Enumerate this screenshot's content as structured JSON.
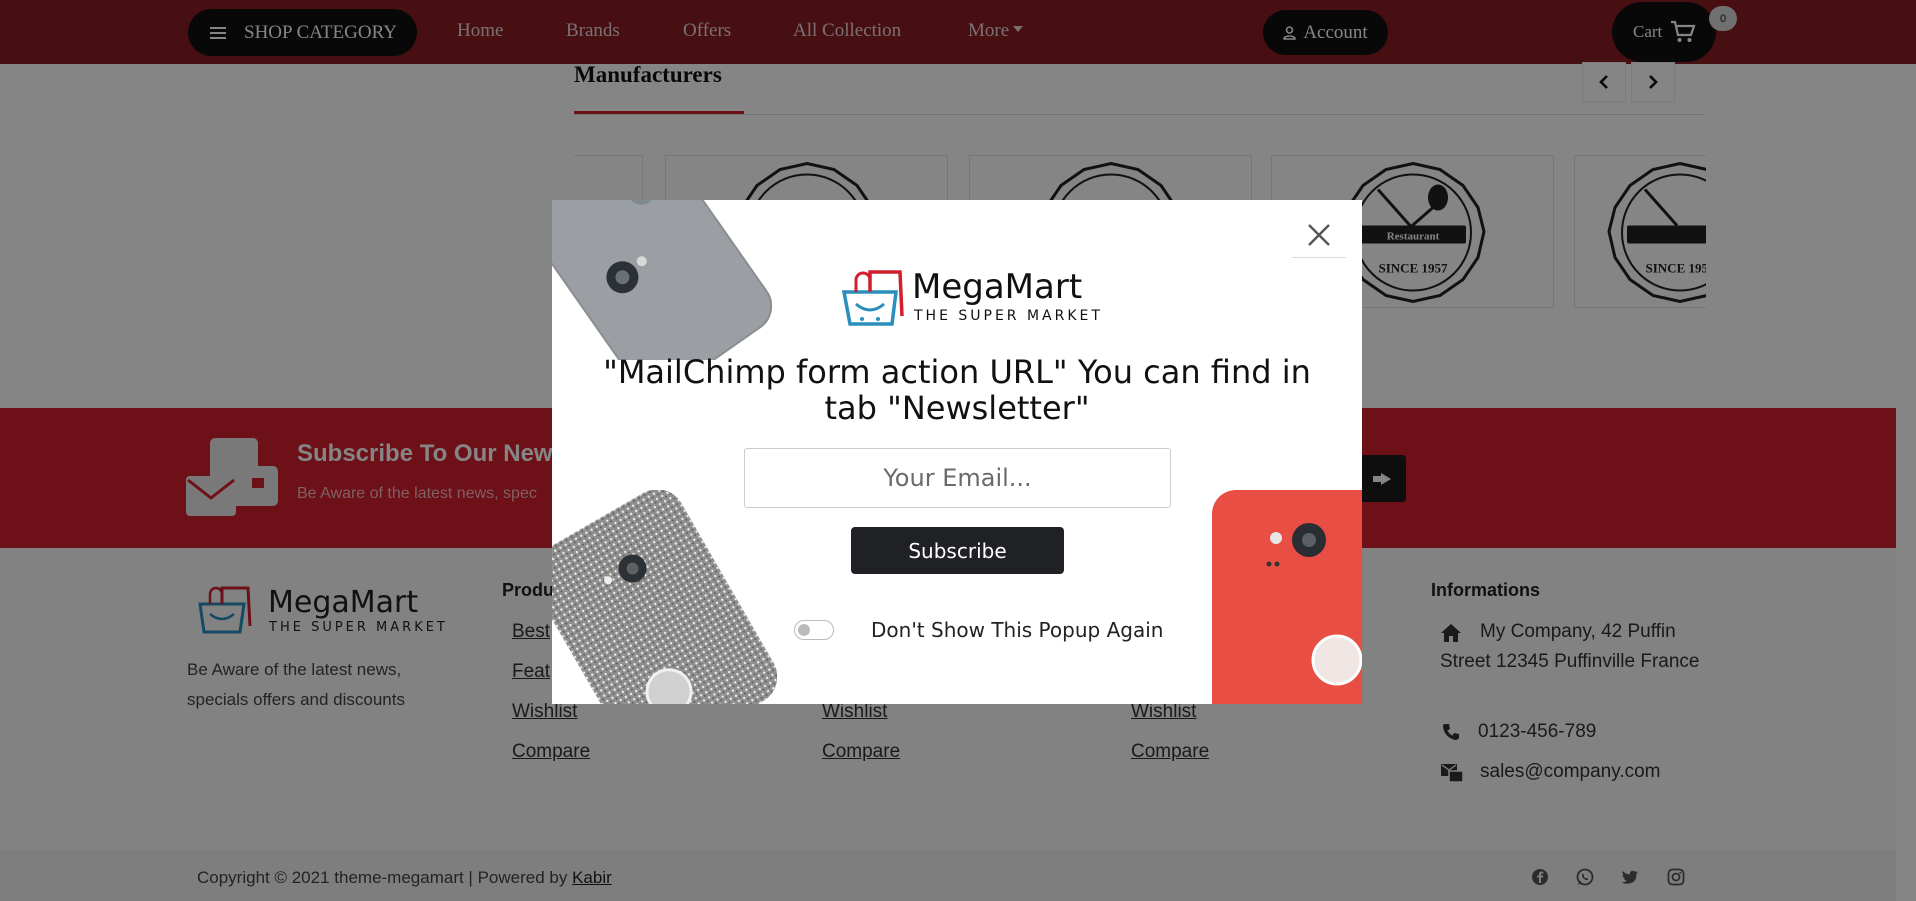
{
  "navbar": {
    "shop_category": "SHOP CATEGORY",
    "links": [
      "Home",
      "Brands",
      "Offers",
      "All Collection",
      "More"
    ],
    "account": "Account",
    "cart": "Cart",
    "cart_count": "0"
  },
  "manufacturers": {
    "title": "Manufacturers",
    "logo_text_top": "Restaurant",
    "logo_text_bottom": "SINCE 1957",
    "logo_text_bottom_cut": "SINC"
  },
  "newsletter": {
    "title": "Subscribe To Our News",
    "subtitle": "Be Aware of the latest news, spec"
  },
  "footer": {
    "logo_name": "MegaMart",
    "logo_tag": "THE SUPER MARKET",
    "description": "Be Aware of the latest news, specials offers and discounts",
    "products_title": "Produ",
    "col1": [
      "Best",
      "Feat",
      "Wishlist",
      "Compare"
    ],
    "col2": [
      "Wishlist",
      "Compare"
    ],
    "col3": [
      "Wishlist",
      "Compare"
    ],
    "informations_title": "Informations",
    "address": "My Company, 42 Puffin Street 12345 Puffinville France",
    "phone": "0123-456-789",
    "email": "sales@company.com",
    "copyright": "Copyright © 2021 theme-megamart | Powered by",
    "powered_by": "Kabir"
  },
  "popup": {
    "logo_name": "MegaMart",
    "logo_tag": "THE SUPER MARKET",
    "heading": "\"MailChimp form action URL\" You can find in tab \"Newsletter\"",
    "email_placeholder": "Your Email...",
    "subscribe": "Subscribe",
    "dont_show": "Don't Show This Popup Again"
  },
  "colors": {
    "brand_red": "#d11f2e",
    "dark": "#1f2124"
  },
  "icons": [
    "menu-icon",
    "user-icon",
    "cart-icon",
    "chevron-left-icon",
    "chevron-right-icon",
    "envelope-icon",
    "send-icon",
    "home-icon",
    "phone-icon",
    "mail-icon",
    "facebook-icon",
    "whatsapp-icon",
    "twitter-icon",
    "instagram-icon",
    "close-icon"
  ]
}
